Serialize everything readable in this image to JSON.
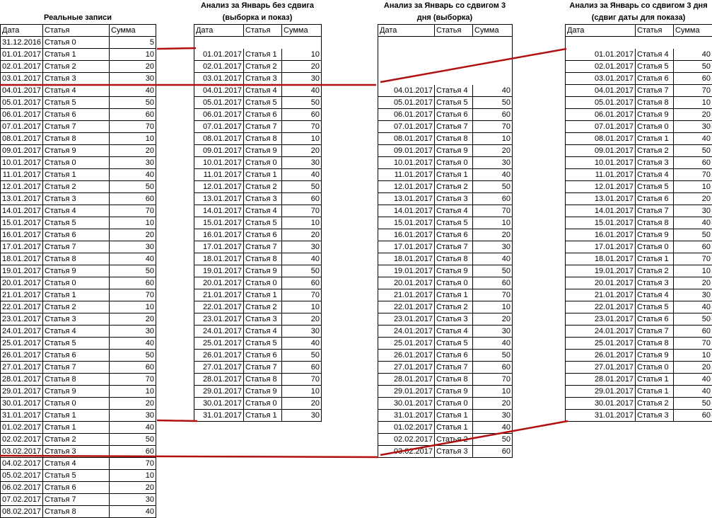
{
  "tables": [
    {
      "title": "Реальные записи",
      "headers": [
        "Дата",
        "Статья",
        "Сумма"
      ],
      "rows": [
        [
          "31.12.2016",
          "Статья 0",
          "5"
        ],
        [
          "01.01.2017",
          "Статья 1",
          "10"
        ],
        [
          "02.01.2017",
          "Статья 2",
          "20"
        ],
        [
          "03.01.2017",
          "Статья 3",
          "30"
        ],
        [
          "04.01.2017",
          "Статья 4",
          "40"
        ],
        [
          "05.01.2017",
          "Статья 5",
          "50"
        ],
        [
          "06.01.2017",
          "Статья 6",
          "60"
        ],
        [
          "07.01.2017",
          "Статья 7",
          "70"
        ],
        [
          "08.01.2017",
          "Статья 8",
          "10"
        ],
        [
          "09.01.2017",
          "Статья 9",
          "20"
        ],
        [
          "10.01.2017",
          "Статья 0",
          "30"
        ],
        [
          "11.01.2017",
          "Статья 1",
          "40"
        ],
        [
          "12.01.2017",
          "Статья 2",
          "50"
        ],
        [
          "13.01.2017",
          "Статья 3",
          "60"
        ],
        [
          "14.01.2017",
          "Статья 4",
          "70"
        ],
        [
          "15.01.2017",
          "Статья 5",
          "10"
        ],
        [
          "16.01.2017",
          "Статья 6",
          "20"
        ],
        [
          "17.01.2017",
          "Статья 7",
          "30"
        ],
        [
          "18.01.2017",
          "Статья 8",
          "40"
        ],
        [
          "19.01.2017",
          "Статья 9",
          "50"
        ],
        [
          "20.01.2017",
          "Статья 0",
          "60"
        ],
        [
          "21.01.2017",
          "Статья 1",
          "70"
        ],
        [
          "22.01.2017",
          "Статья 2",
          "10"
        ],
        [
          "23.01.2017",
          "Статья 3",
          "20"
        ],
        [
          "24.01.2017",
          "Статья 4",
          "30"
        ],
        [
          "25.01.2017",
          "Статья 5",
          "40"
        ],
        [
          "26.01.2017",
          "Статья 6",
          "50"
        ],
        [
          "27.01.2017",
          "Статья 7",
          "60"
        ],
        [
          "28.01.2017",
          "Статья 8",
          "70"
        ],
        [
          "29.01.2017",
          "Статья 9",
          "10"
        ],
        [
          "30.01.2017",
          "Статья 0",
          "20"
        ],
        [
          "31.01.2017",
          "Статья 1",
          "30"
        ],
        [
          "01.02.2017",
          "Статья 1",
          "40"
        ],
        [
          "02.02.2017",
          "Статья 2",
          "50"
        ],
        [
          "03.02.2017",
          "Статья 3",
          "60"
        ],
        [
          "04.02.2017",
          "Статья 4",
          "70"
        ],
        [
          "05.02.2017",
          "Статья 5",
          "10"
        ],
        [
          "06.02.2017",
          "Статья 6",
          "20"
        ],
        [
          "07.02.2017",
          "Статья 7",
          "30"
        ],
        [
          "08.02.2017",
          "Статья 8",
          "40"
        ]
      ]
    },
    {
      "title": "Анализ за Январь без сдвига (выборка и показ)",
      "headers": [
        "Дата",
        "Статья",
        "Сумма"
      ],
      "blank_before": 1,
      "rows": [
        [
          "01.01.2017",
          "Статья 1",
          "10"
        ],
        [
          "02.01.2017",
          "Статья 2",
          "20"
        ],
        [
          "03.01.2017",
          "Статья 3",
          "30"
        ],
        [
          "04.01.2017",
          "Статья 4",
          "40"
        ],
        [
          "05.01.2017",
          "Статья 5",
          "50"
        ],
        [
          "06.01.2017",
          "Статья 6",
          "60"
        ],
        [
          "07.01.2017",
          "Статья 7",
          "70"
        ],
        [
          "08.01.2017",
          "Статья 8",
          "10"
        ],
        [
          "09.01.2017",
          "Статья 9",
          "20"
        ],
        [
          "10.01.2017",
          "Статья 0",
          "30"
        ],
        [
          "11.01.2017",
          "Статья 1",
          "40"
        ],
        [
          "12.01.2017",
          "Статья 2",
          "50"
        ],
        [
          "13.01.2017",
          "Статья 3",
          "60"
        ],
        [
          "14.01.2017",
          "Статья 4",
          "70"
        ],
        [
          "15.01.2017",
          "Статья 5",
          "10"
        ],
        [
          "16.01.2017",
          "Статья 6",
          "20"
        ],
        [
          "17.01.2017",
          "Статья 7",
          "30"
        ],
        [
          "18.01.2017",
          "Статья 8",
          "40"
        ],
        [
          "19.01.2017",
          "Статья 9",
          "50"
        ],
        [
          "20.01.2017",
          "Статья 0",
          "60"
        ],
        [
          "21.01.2017",
          "Статья 1",
          "70"
        ],
        [
          "22.01.2017",
          "Статья 2",
          "10"
        ],
        [
          "23.01.2017",
          "Статья 3",
          "20"
        ],
        [
          "24.01.2017",
          "Статья 4",
          "30"
        ],
        [
          "25.01.2017",
          "Статья 5",
          "40"
        ],
        [
          "26.01.2017",
          "Статья 6",
          "50"
        ],
        [
          "27.01.2017",
          "Статья 7",
          "60"
        ],
        [
          "28.01.2017",
          "Статья 8",
          "70"
        ],
        [
          "29.01.2017",
          "Статья 9",
          "10"
        ],
        [
          "30.01.2017",
          "Статья 0",
          "20"
        ],
        [
          "31.01.2017",
          "Статья 1",
          "30"
        ]
      ]
    },
    {
      "title": "Анализ за Январь со сдвигом 3 дня (выборка)",
      "headers": [
        "Дата",
        "Статья",
        "Сумма"
      ],
      "blank_before": 4,
      "rows": [
        [
          "04.01.2017",
          "Статья 4",
          "40"
        ],
        [
          "05.01.2017",
          "Статья 5",
          "50"
        ],
        [
          "06.01.2017",
          "Статья 6",
          "60"
        ],
        [
          "07.01.2017",
          "Статья 7",
          "70"
        ],
        [
          "08.01.2017",
          "Статья 8",
          "10"
        ],
        [
          "09.01.2017",
          "Статья 9",
          "20"
        ],
        [
          "10.01.2017",
          "Статья 0",
          "30"
        ],
        [
          "11.01.2017",
          "Статья 1",
          "40"
        ],
        [
          "12.01.2017",
          "Статья 2",
          "50"
        ],
        [
          "13.01.2017",
          "Статья 3",
          "60"
        ],
        [
          "14.01.2017",
          "Статья 4",
          "70"
        ],
        [
          "15.01.2017",
          "Статья 5",
          "10"
        ],
        [
          "16.01.2017",
          "Статья 6",
          "20"
        ],
        [
          "17.01.2017",
          "Статья 7",
          "30"
        ],
        [
          "18.01.2017",
          "Статья 8",
          "40"
        ],
        [
          "19.01.2017",
          "Статья 9",
          "50"
        ],
        [
          "20.01.2017",
          "Статья 0",
          "60"
        ],
        [
          "21.01.2017",
          "Статья 1",
          "70"
        ],
        [
          "22.01.2017",
          "Статья 2",
          "10"
        ],
        [
          "23.01.2017",
          "Статья 3",
          "20"
        ],
        [
          "24.01.2017",
          "Статья 4",
          "30"
        ],
        [
          "25.01.2017",
          "Статья 5",
          "40"
        ],
        [
          "26.01.2017",
          "Статья 6",
          "50"
        ],
        [
          "27.01.2017",
          "Статья 7",
          "60"
        ],
        [
          "28.01.2017",
          "Статья 8",
          "70"
        ],
        [
          "29.01.2017",
          "Статья 9",
          "10"
        ],
        [
          "30.01.2017",
          "Статья 0",
          "20"
        ],
        [
          "31.01.2017",
          "Статья 1",
          "30"
        ],
        [
          "01.02.2017",
          "Статья 1",
          "40"
        ],
        [
          "02.02.2017",
          "Статья 2",
          "50"
        ],
        [
          "03.02.2017",
          "Статья 3",
          "60"
        ]
      ]
    },
    {
      "title": "Анализ за Январь со сдвигом 3 дня (сдвиг даты для показа)",
      "headers": [
        "Дата",
        "Статья",
        "Сумма"
      ],
      "blank_before": 1,
      "rows": [
        [
          "01.01.2017",
          "Статья 4",
          "40"
        ],
        [
          "02.01.2017",
          "Статья 5",
          "50"
        ],
        [
          "03.01.2017",
          "Статья 6",
          "60"
        ],
        [
          "04.01.2017",
          "Статья 7",
          "70"
        ],
        [
          "05.01.2017",
          "Статья 8",
          "10"
        ],
        [
          "06.01.2017",
          "Статья 9",
          "20"
        ],
        [
          "07.01.2017",
          "Статья 0",
          "30"
        ],
        [
          "08.01.2017",
          "Статья 1",
          "40"
        ],
        [
          "09.01.2017",
          "Статья 2",
          "50"
        ],
        [
          "10.01.2017",
          "Статья 3",
          "60"
        ],
        [
          "11.01.2017",
          "Статья 4",
          "70"
        ],
        [
          "12.01.2017",
          "Статья 5",
          "10"
        ],
        [
          "13.01.2017",
          "Статья 6",
          "20"
        ],
        [
          "14.01.2017",
          "Статья 7",
          "30"
        ],
        [
          "15.01.2017",
          "Статья 8",
          "40"
        ],
        [
          "16.01.2017",
          "Статья 9",
          "50"
        ],
        [
          "17.01.2017",
          "Статья 0",
          "60"
        ],
        [
          "18.01.2017",
          "Статья 1",
          "70"
        ],
        [
          "19.01.2017",
          "Статья 2",
          "10"
        ],
        [
          "20.01.2017",
          "Статья 3",
          "20"
        ],
        [
          "21.01.2017",
          "Статья 4",
          "30"
        ],
        [
          "22.01.2017",
          "Статья 5",
          "40"
        ],
        [
          "23.01.2017",
          "Статья 6",
          "50"
        ],
        [
          "24.01.2017",
          "Статья 7",
          "60"
        ],
        [
          "25.01.2017",
          "Статья 8",
          "70"
        ],
        [
          "26.01.2017",
          "Статья 9",
          "10"
        ],
        [
          "27.01.2017",
          "Статья 0",
          "20"
        ],
        [
          "28.01.2017",
          "Статья 1",
          "40"
        ],
        [
          "29.01.2017",
          "Статья 1",
          "40"
        ],
        [
          "30.01.2017",
          "Статья 2",
          "50"
        ],
        [
          "31.01.2017",
          "Статья 3",
          "60"
        ]
      ]
    }
  ],
  "annotation_color": "#b01010"
}
